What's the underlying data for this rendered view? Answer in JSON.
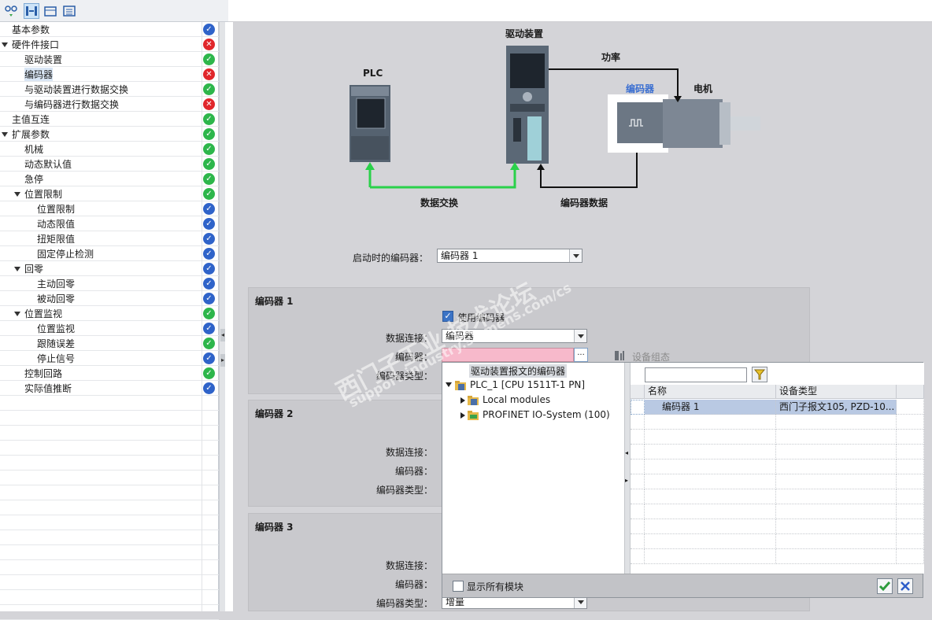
{
  "tree": {
    "items": [
      {
        "label": "基本参数",
        "indent": 1,
        "status": "blue",
        "caret": false
      },
      {
        "label": "硬件件接口",
        "indent": 1,
        "status": "red",
        "caret": true
      },
      {
        "label": "驱动装置",
        "indent": 2,
        "status": "green",
        "caret": false
      },
      {
        "label": "编码器",
        "indent": 2,
        "status": "red",
        "caret": false,
        "selected": true
      },
      {
        "label": "与驱动装置进行数据交换",
        "indent": 2,
        "status": "green",
        "caret": false
      },
      {
        "label": "与编码器进行数据交换",
        "indent": 2,
        "status": "red",
        "caret": false
      },
      {
        "label": "主值互连",
        "indent": 1,
        "status": "green",
        "caret": false
      },
      {
        "label": "扩展参数",
        "indent": 1,
        "status": "green",
        "caret": true
      },
      {
        "label": "机械",
        "indent": 2,
        "status": "green",
        "caret": false
      },
      {
        "label": "动态默认值",
        "indent": 2,
        "status": "green",
        "caret": false
      },
      {
        "label": "急停",
        "indent": 2,
        "status": "green",
        "caret": false
      },
      {
        "label": "位置限制",
        "indent": 2,
        "status": "green",
        "caret": true
      },
      {
        "label": "位置限制",
        "indent": 3,
        "status": "blue",
        "caret": false
      },
      {
        "label": "动态限值",
        "indent": 3,
        "status": "blue",
        "caret": false
      },
      {
        "label": "扭矩限值",
        "indent": 3,
        "status": "blue",
        "caret": false
      },
      {
        "label": "固定停止检测",
        "indent": 3,
        "status": "blue",
        "caret": false
      },
      {
        "label": "回零",
        "indent": 2,
        "status": "blue",
        "caret": true
      },
      {
        "label": "主动回零",
        "indent": 3,
        "status": "blue",
        "caret": false
      },
      {
        "label": "被动回零",
        "indent": 3,
        "status": "blue",
        "caret": false
      },
      {
        "label": "位置监视",
        "indent": 2,
        "status": "green",
        "caret": true
      },
      {
        "label": "位置监视",
        "indent": 3,
        "status": "blue",
        "caret": false
      },
      {
        "label": "跟随误差",
        "indent": 3,
        "status": "green",
        "caret": false
      },
      {
        "label": "停止信号",
        "indent": 3,
        "status": "blue",
        "caret": false
      },
      {
        "label": "控制回路",
        "indent": 2,
        "status": "green",
        "caret": false
      },
      {
        "label": "实际值推断",
        "indent": 2,
        "status": "blue",
        "caret": false
      }
    ]
  },
  "colors": {
    "green": "#2db64b",
    "red": "#e0262b",
    "blue": "#2f63c9",
    "arrow_green": "#2ad14a"
  },
  "diagram": {
    "plc_label": "PLC",
    "drive_label": "驱动装置",
    "power_label": "功率",
    "encoder_label": "编码器",
    "motor_label": "电机",
    "data_exchange_label": "数据交换",
    "encoder_data_label": "编码器数据"
  },
  "startup": {
    "label": "启动时的编码器：",
    "value": "编码器 1"
  },
  "encoder1": {
    "title": "编码器 1",
    "use_encoder_label": "使用编码器",
    "use_encoder_checked": true,
    "data_conn_label": "数据连接：",
    "data_conn_value": "编码器",
    "encoder_label": "编码器：",
    "ellipsis": "...",
    "device_config": "设备组态",
    "encoder_type_label": "编码器类型："
  },
  "encoder2": {
    "title": "编码器 2",
    "data_conn_label": "数据连接：",
    "encoder_label": "编码器：",
    "encoder_type_label": "编码器类型："
  },
  "encoder3": {
    "title": "编码器 3",
    "data_conn_label": "数据连接：",
    "encoder_label": "编码器：",
    "encoder_type_label": "编码器类型：",
    "encoder_type_value": "增量"
  },
  "popup": {
    "tree": [
      {
        "label": "驱动装置报文的编码器",
        "level": 1,
        "selected": true
      },
      {
        "label": "PLC_1 [CPU 1511T-1 PN]",
        "level": 0,
        "expanded": true
      },
      {
        "label": "Local modules",
        "level": 1,
        "expanded": false
      },
      {
        "label": "PROFINET IO-System (100)",
        "level": 1,
        "expanded": false
      }
    ],
    "columns": [
      "名称",
      "设备类型"
    ],
    "rows": [
      {
        "name": "编码器 1",
        "type": "西门子报文105, PZD-10..."
      }
    ],
    "show_all_label": "显示所有模块"
  },
  "watermark": {
    "line1": "西门子工业 技术论坛",
    "line2": "support.industry.siemens.com/cs"
  }
}
